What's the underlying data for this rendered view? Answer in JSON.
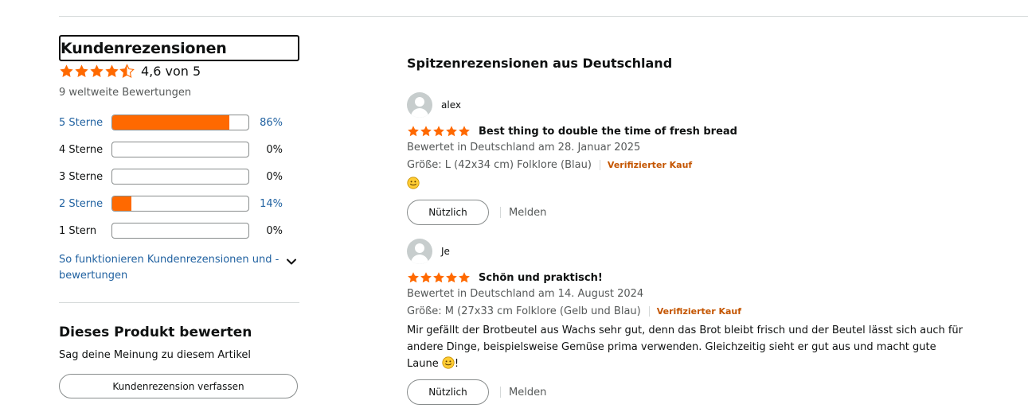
{
  "summary": {
    "heading": "Kundenrezensionen",
    "average_text": "4,6 von 5",
    "average_rating": 4.6,
    "total_text": "9 weltweite Bewertungen",
    "histogram": [
      {
        "label": "5 Sterne",
        "pct_text": "86%",
        "percent": 86,
        "link": true
      },
      {
        "label": "4 Sterne",
        "pct_text": "0%",
        "percent": 0,
        "link": false
      },
      {
        "label": "3 Sterne",
        "pct_text": "0%",
        "percent": 0,
        "link": false
      },
      {
        "label": "2 Sterne",
        "pct_text": "14%",
        "percent": 14,
        "link": true
      },
      {
        "label": "1 Stern",
        "pct_text": "0%",
        "percent": 0,
        "link": false
      }
    ],
    "how_it_works": "So funktionieren Kundenrezensionen und -bewertungen"
  },
  "rate_product": {
    "heading": "Dieses Produkt bewerten",
    "subtext": "Sag deine Meinung zu diesem Artikel",
    "button_label": "Kundenrezension verfassen"
  },
  "top_reviews": {
    "heading": "Spitzenrezensionen aus Deutschland",
    "reviews": [
      {
        "user": "alex",
        "rating": 5,
        "title": "Best thing to double the time of fresh bread",
        "date_text": "Bewertet in Deutschland am 28. Januar 2025",
        "variant": "Größe: L (42x34 cm) Folklore (Blau)",
        "verified": "Verifizierter Kauf",
        "body_before_emoji": "",
        "body_after_emoji": "",
        "helpful_label": "Nützlich",
        "report_label": "Melden"
      },
      {
        "user": "Je",
        "rating": 5,
        "title": "Schön und praktisch!",
        "date_text": "Bewertet in Deutschland am 14. August 2024",
        "variant": "Größe: M (27x33 cm Folklore (Gelb und Blau)",
        "verified": "Verifizierter Kauf",
        "body_before_emoji": "Mir gefällt der Brotbeutel aus Wachs sehr gut, denn das Brot bleibt frisch und der Beutel lässt sich auch für andere Dinge, beispielsweise Gemüse prima verwenden. Gleichzeitig sieht er gut aus und macht gute Laune ",
        "body_after_emoji": "!",
        "helpful_label": "Nützlich",
        "report_label": "Melden"
      }
    ]
  },
  "colors": {
    "star": "#ff6900",
    "bar_fill": "#ff6900",
    "link": "#2162a1",
    "verified": "#c45500",
    "muted": "#565959"
  },
  "icons": {
    "star": "star-icon",
    "half_star": "half-star-icon",
    "chevron": "chevron-down-icon",
    "avatar": "user-avatar-icon",
    "emoji": "smiley-emoji-icon"
  }
}
